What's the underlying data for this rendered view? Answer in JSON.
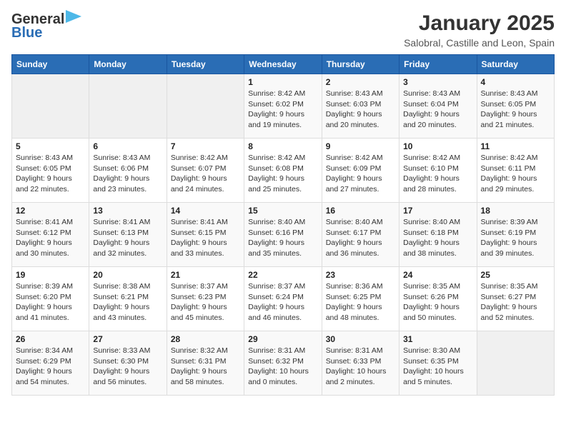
{
  "header": {
    "logo_line1": "General",
    "logo_line2": "Blue",
    "month": "January 2025",
    "location": "Salobral, Castille and Leon, Spain"
  },
  "weekdays": [
    "Sunday",
    "Monday",
    "Tuesday",
    "Wednesday",
    "Thursday",
    "Friday",
    "Saturday"
  ],
  "weeks": [
    [
      {
        "day": "",
        "info": ""
      },
      {
        "day": "",
        "info": ""
      },
      {
        "day": "",
        "info": ""
      },
      {
        "day": "1",
        "info": "Sunrise: 8:42 AM\nSunset: 6:02 PM\nDaylight: 9 hours and 19 minutes."
      },
      {
        "day": "2",
        "info": "Sunrise: 8:43 AM\nSunset: 6:03 PM\nDaylight: 9 hours and 20 minutes."
      },
      {
        "day": "3",
        "info": "Sunrise: 8:43 AM\nSunset: 6:04 PM\nDaylight: 9 hours and 20 minutes."
      },
      {
        "day": "4",
        "info": "Sunrise: 8:43 AM\nSunset: 6:05 PM\nDaylight: 9 hours and 21 minutes."
      }
    ],
    [
      {
        "day": "5",
        "info": "Sunrise: 8:43 AM\nSunset: 6:05 PM\nDaylight: 9 hours and 22 minutes."
      },
      {
        "day": "6",
        "info": "Sunrise: 8:43 AM\nSunset: 6:06 PM\nDaylight: 9 hours and 23 minutes."
      },
      {
        "day": "7",
        "info": "Sunrise: 8:42 AM\nSunset: 6:07 PM\nDaylight: 9 hours and 24 minutes."
      },
      {
        "day": "8",
        "info": "Sunrise: 8:42 AM\nSunset: 6:08 PM\nDaylight: 9 hours and 25 minutes."
      },
      {
        "day": "9",
        "info": "Sunrise: 8:42 AM\nSunset: 6:09 PM\nDaylight: 9 hours and 27 minutes."
      },
      {
        "day": "10",
        "info": "Sunrise: 8:42 AM\nSunset: 6:10 PM\nDaylight: 9 hours and 28 minutes."
      },
      {
        "day": "11",
        "info": "Sunrise: 8:42 AM\nSunset: 6:11 PM\nDaylight: 9 hours and 29 minutes."
      }
    ],
    [
      {
        "day": "12",
        "info": "Sunrise: 8:41 AM\nSunset: 6:12 PM\nDaylight: 9 hours and 30 minutes."
      },
      {
        "day": "13",
        "info": "Sunrise: 8:41 AM\nSunset: 6:13 PM\nDaylight: 9 hours and 32 minutes."
      },
      {
        "day": "14",
        "info": "Sunrise: 8:41 AM\nSunset: 6:15 PM\nDaylight: 9 hours and 33 minutes."
      },
      {
        "day": "15",
        "info": "Sunrise: 8:40 AM\nSunset: 6:16 PM\nDaylight: 9 hours and 35 minutes."
      },
      {
        "day": "16",
        "info": "Sunrise: 8:40 AM\nSunset: 6:17 PM\nDaylight: 9 hours and 36 minutes."
      },
      {
        "day": "17",
        "info": "Sunrise: 8:40 AM\nSunset: 6:18 PM\nDaylight: 9 hours and 38 minutes."
      },
      {
        "day": "18",
        "info": "Sunrise: 8:39 AM\nSunset: 6:19 PM\nDaylight: 9 hours and 39 minutes."
      }
    ],
    [
      {
        "day": "19",
        "info": "Sunrise: 8:39 AM\nSunset: 6:20 PM\nDaylight: 9 hours and 41 minutes."
      },
      {
        "day": "20",
        "info": "Sunrise: 8:38 AM\nSunset: 6:21 PM\nDaylight: 9 hours and 43 minutes."
      },
      {
        "day": "21",
        "info": "Sunrise: 8:37 AM\nSunset: 6:23 PM\nDaylight: 9 hours and 45 minutes."
      },
      {
        "day": "22",
        "info": "Sunrise: 8:37 AM\nSunset: 6:24 PM\nDaylight: 9 hours and 46 minutes."
      },
      {
        "day": "23",
        "info": "Sunrise: 8:36 AM\nSunset: 6:25 PM\nDaylight: 9 hours and 48 minutes."
      },
      {
        "day": "24",
        "info": "Sunrise: 8:35 AM\nSunset: 6:26 PM\nDaylight: 9 hours and 50 minutes."
      },
      {
        "day": "25",
        "info": "Sunrise: 8:35 AM\nSunset: 6:27 PM\nDaylight: 9 hours and 52 minutes."
      }
    ],
    [
      {
        "day": "26",
        "info": "Sunrise: 8:34 AM\nSunset: 6:29 PM\nDaylight: 9 hours and 54 minutes."
      },
      {
        "day": "27",
        "info": "Sunrise: 8:33 AM\nSunset: 6:30 PM\nDaylight: 9 hours and 56 minutes."
      },
      {
        "day": "28",
        "info": "Sunrise: 8:32 AM\nSunset: 6:31 PM\nDaylight: 9 hours and 58 minutes."
      },
      {
        "day": "29",
        "info": "Sunrise: 8:31 AM\nSunset: 6:32 PM\nDaylight: 10 hours and 0 minutes."
      },
      {
        "day": "30",
        "info": "Sunrise: 8:31 AM\nSunset: 6:33 PM\nDaylight: 10 hours and 2 minutes."
      },
      {
        "day": "31",
        "info": "Sunrise: 8:30 AM\nSunset: 6:35 PM\nDaylight: 10 hours and 5 minutes."
      },
      {
        "day": "",
        "info": ""
      }
    ]
  ]
}
